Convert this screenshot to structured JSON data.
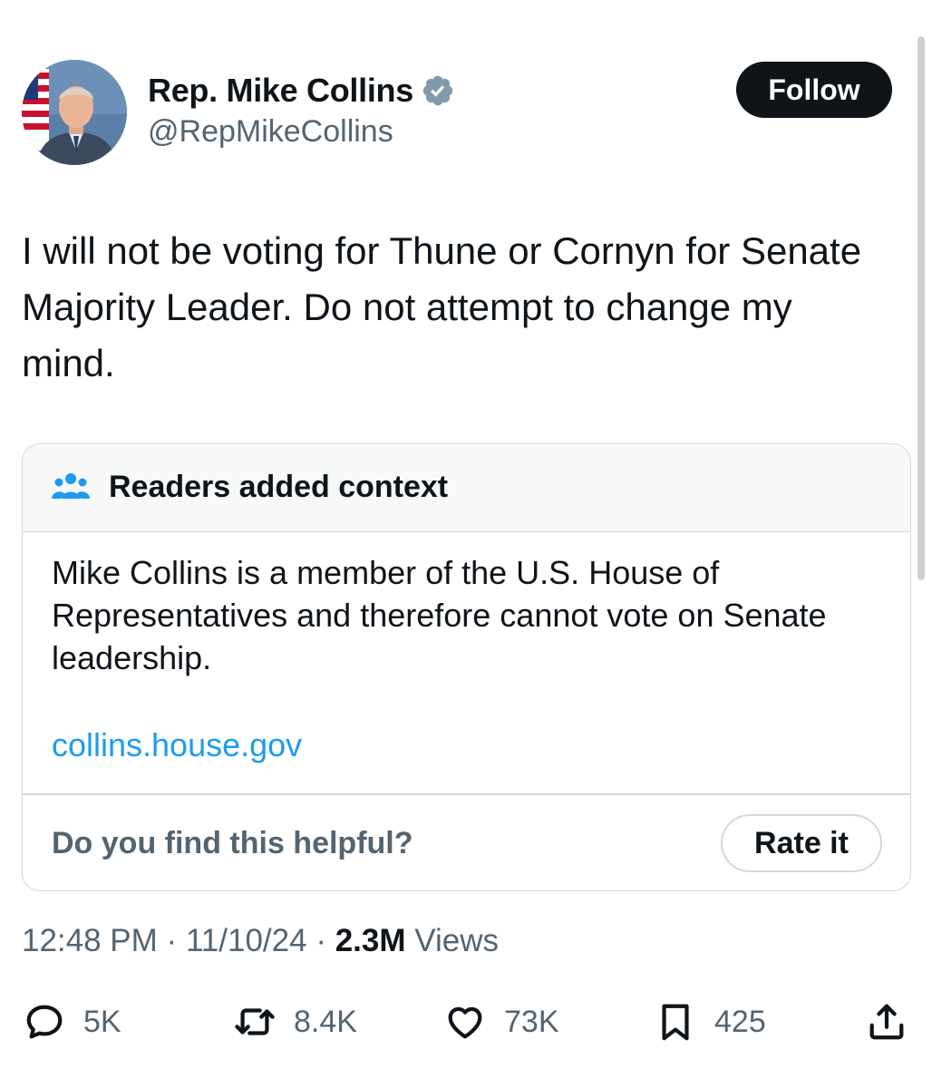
{
  "author": {
    "name": "Rep. Mike Collins",
    "handle": "@RepMikeCollins",
    "verified_icon": "verified-badge-icon",
    "verified_color": "#829aab"
  },
  "follow_label": "Follow",
  "tweet": {
    "text": "I will not be voting for Thune or Cornyn for Senate Majority Leader. Do not attempt to change my mind."
  },
  "community_note": {
    "title": "Readers added context",
    "icon": "people-icon",
    "body": "Mike Collins is a member of the U.S. House of Representatives and therefore cannot vote on Senate leadership.",
    "link": "collins.house.gov",
    "helpful_prompt": "Do you find this helpful?",
    "rate_label": "Rate it"
  },
  "meta": {
    "time": "12:48 PM",
    "separator": "·",
    "date": "11/10/24",
    "views_count": "2.3M",
    "views_label": "Views"
  },
  "actions": {
    "replies": "5K",
    "reposts": "8.4K",
    "likes": "73K",
    "bookmarks": "425"
  },
  "colors": {
    "text": "#0f1419",
    "secondary": "#536471",
    "link": "#1d9bf0",
    "border": "#cfd9de",
    "note_header_bg": "#f7f9f9"
  }
}
